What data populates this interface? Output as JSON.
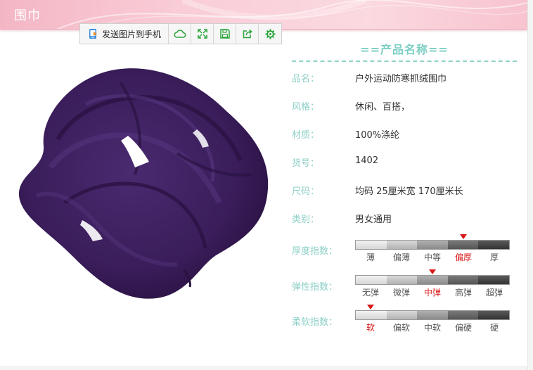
{
  "header": {
    "title": "围巾"
  },
  "toolbar": {
    "send_label": "发送图片到手机",
    "icons": [
      "phone-send-icon",
      "cloud-icon",
      "fullscreen-icon",
      "save-icon",
      "share-icon",
      "gear-icon"
    ]
  },
  "product": {
    "name_title": "==产品名称==",
    "fields": [
      {
        "label": "品名：",
        "value": "户外运动防寒抓绒围巾"
      },
      {
        "label": "风格：",
        "value": "休闲、百搭，"
      },
      {
        "label": "材质：",
        "value": "100%涤纶"
      },
      {
        "label": "货号：",
        "value": "1402"
      },
      {
        "label": "尺码：",
        "value": "均码  25厘米宽  170厘米长"
      },
      {
        "label": "类别：",
        "value": "男女通用"
      }
    ]
  },
  "indices": [
    {
      "label": "厚度指数：",
      "levels": [
        "薄",
        "偏薄",
        "中等",
        "偏厚",
        "厚"
      ],
      "selected": 3
    },
    {
      "label": "弹性指数：",
      "levels": [
        "无弹",
        "微弹",
        "中弹",
        "高弹",
        "超弹"
      ],
      "selected": 2
    },
    {
      "label": "柔软指数：",
      "levels": [
        "软",
        "偏软",
        "中软",
        "偏硬",
        "硬"
      ],
      "selected": 0
    }
  ],
  "colors": {
    "header_pink": "#f9cdd7",
    "label_teal": "#8ccfc6",
    "title_teal": "#7dcfc4",
    "marker_red": "#d81818",
    "scarf_purple": "#3b1f5c",
    "icon_green": "#2aa53a"
  }
}
